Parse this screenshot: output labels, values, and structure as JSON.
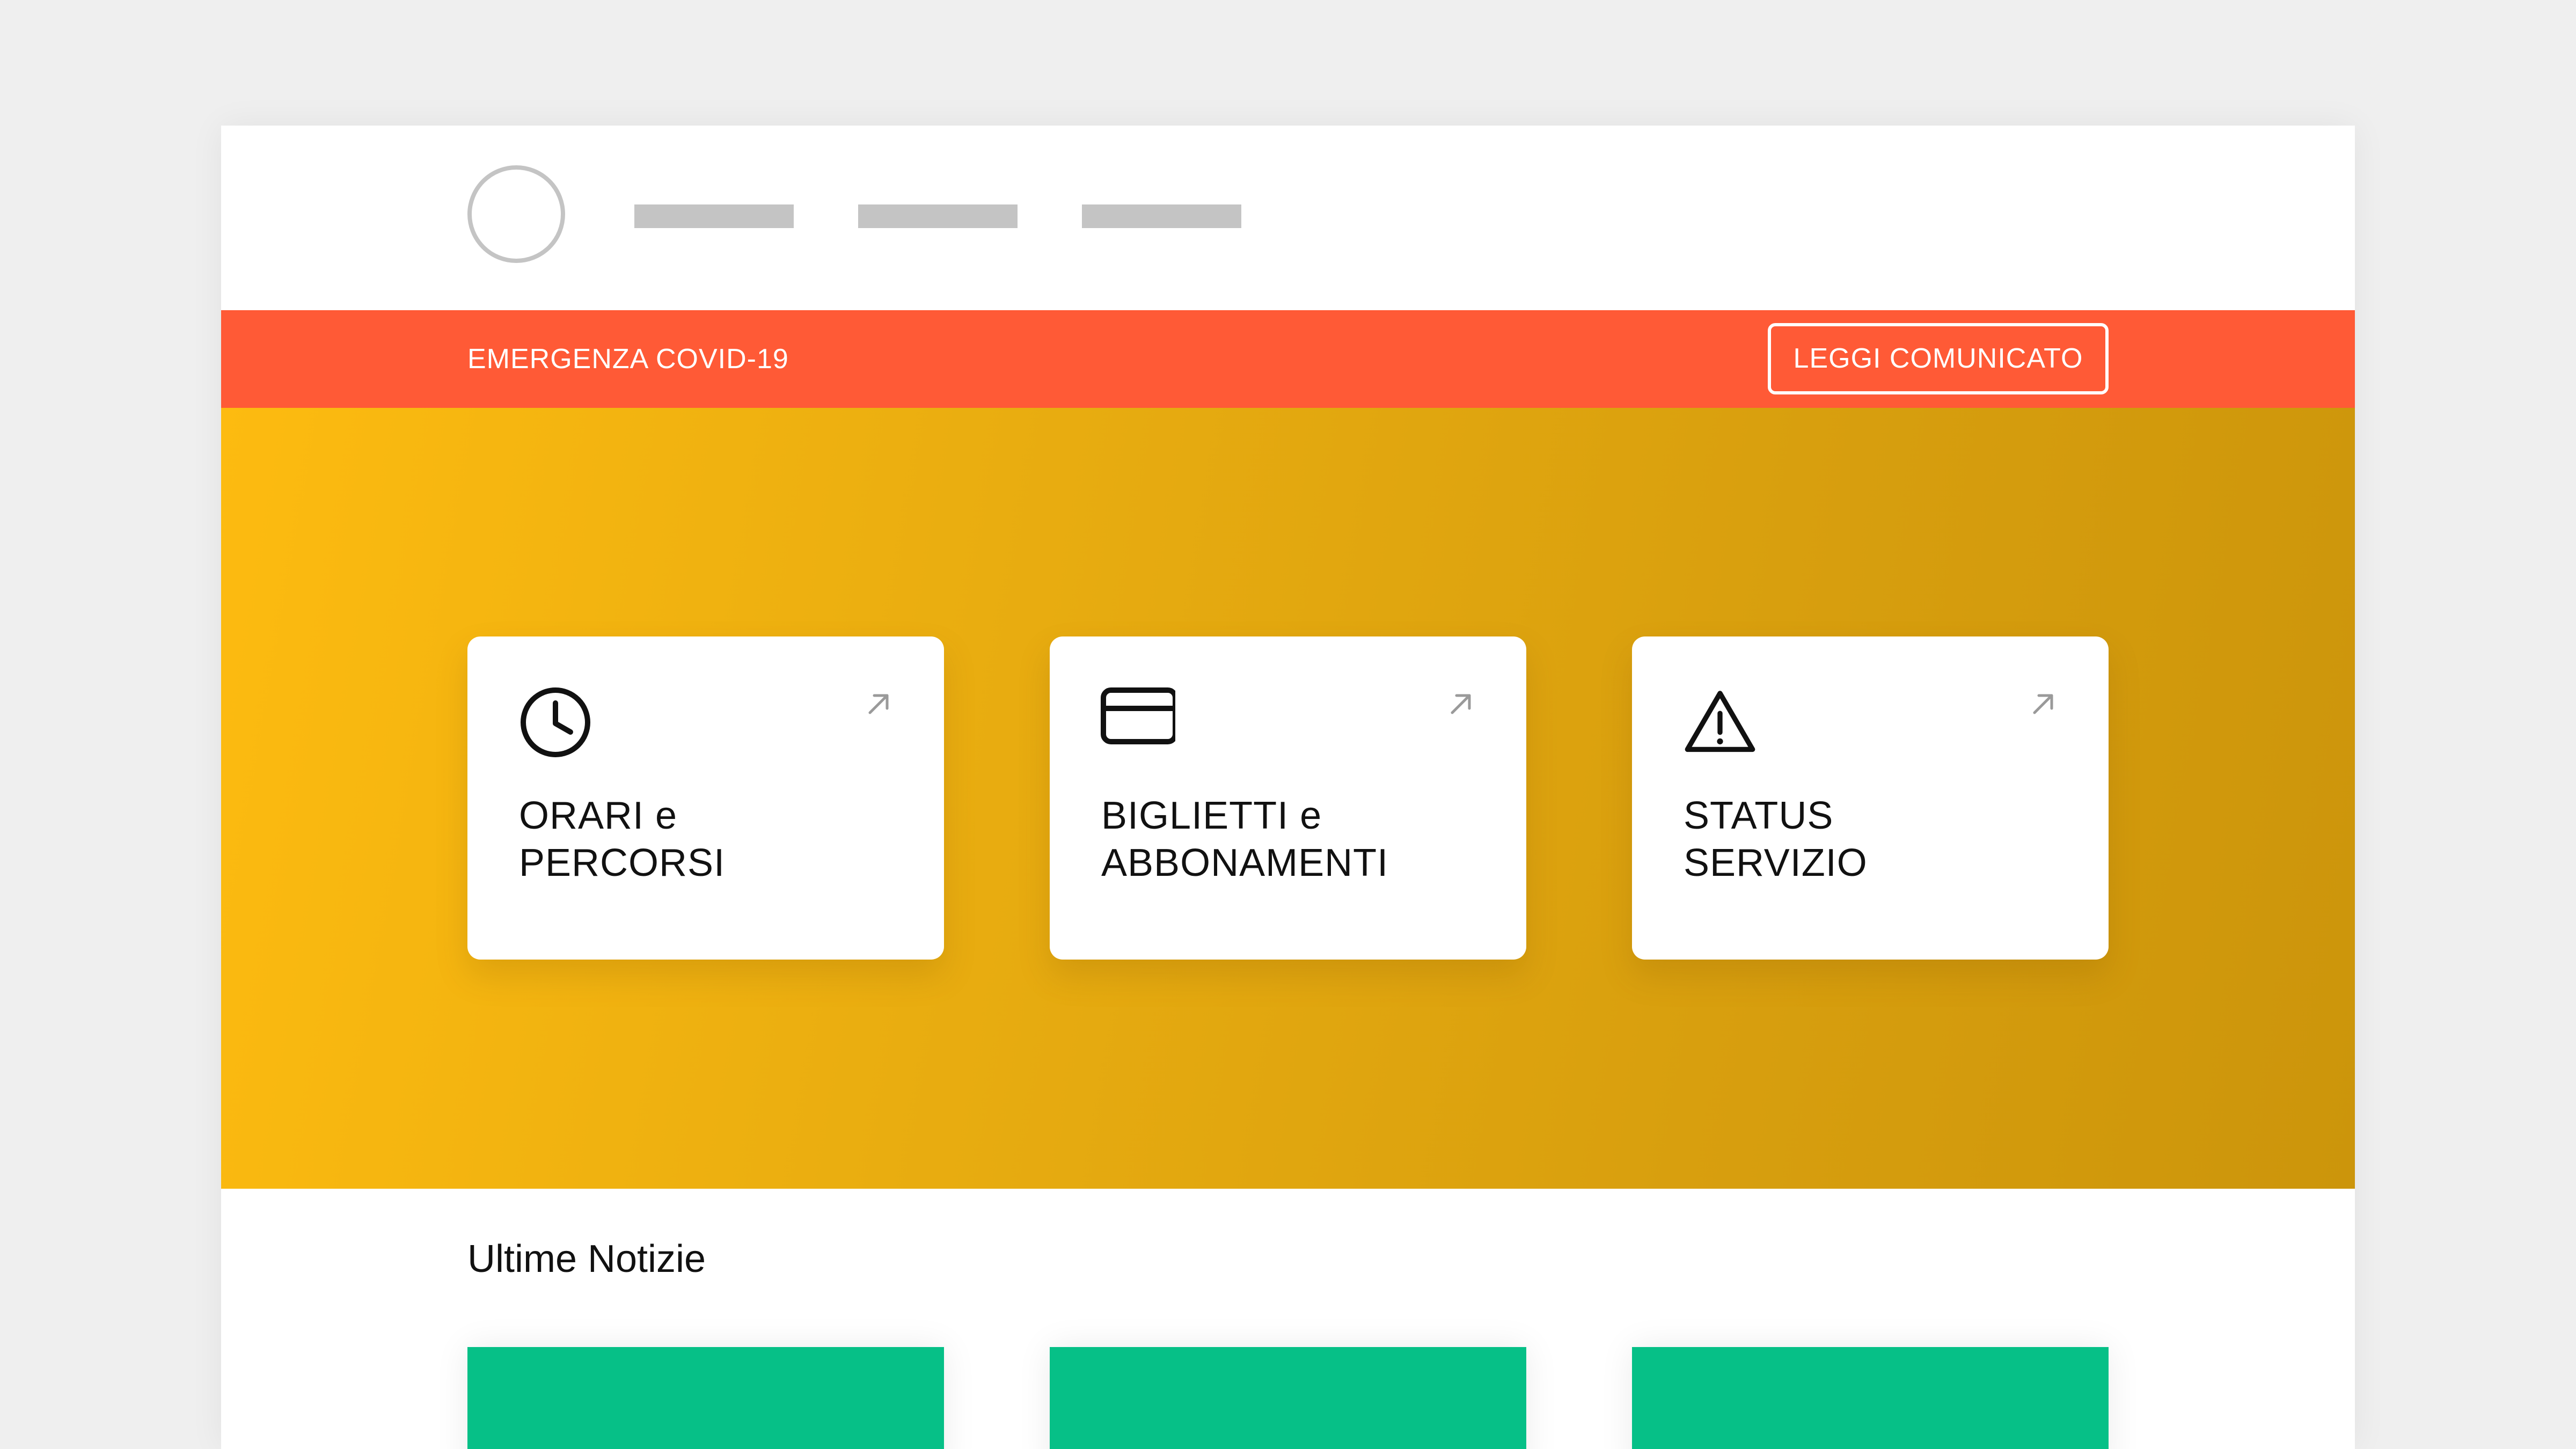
{
  "header": {
    "logo_icon": "circle-logo-placeholder",
    "nav_items": [
      "",
      "",
      ""
    ]
  },
  "alert": {
    "message": "EMERGENZA COVID-19",
    "button_label": "LEGGI COMUNICATO",
    "color": "#ff5a36"
  },
  "hero": {
    "colors": [
      "#fdbb10",
      "#cc950b"
    ],
    "cards": [
      {
        "icon": "clock-icon",
        "line1": "ORARI e",
        "line2": "PERCORSI",
        "arrow": "arrow-up-right-icon"
      },
      {
        "icon": "card-icon",
        "line1": "BIGLIETTI e",
        "line2": "ABBONAMENTI",
        "arrow": "arrow-up-right-icon"
      },
      {
        "icon": "warning-icon",
        "line1": "STATUS",
        "line2": "SERVIZIO",
        "arrow": "arrow-up-right-icon"
      }
    ]
  },
  "news": {
    "heading": "Ultime Notizie",
    "card_color": "#06c087"
  }
}
